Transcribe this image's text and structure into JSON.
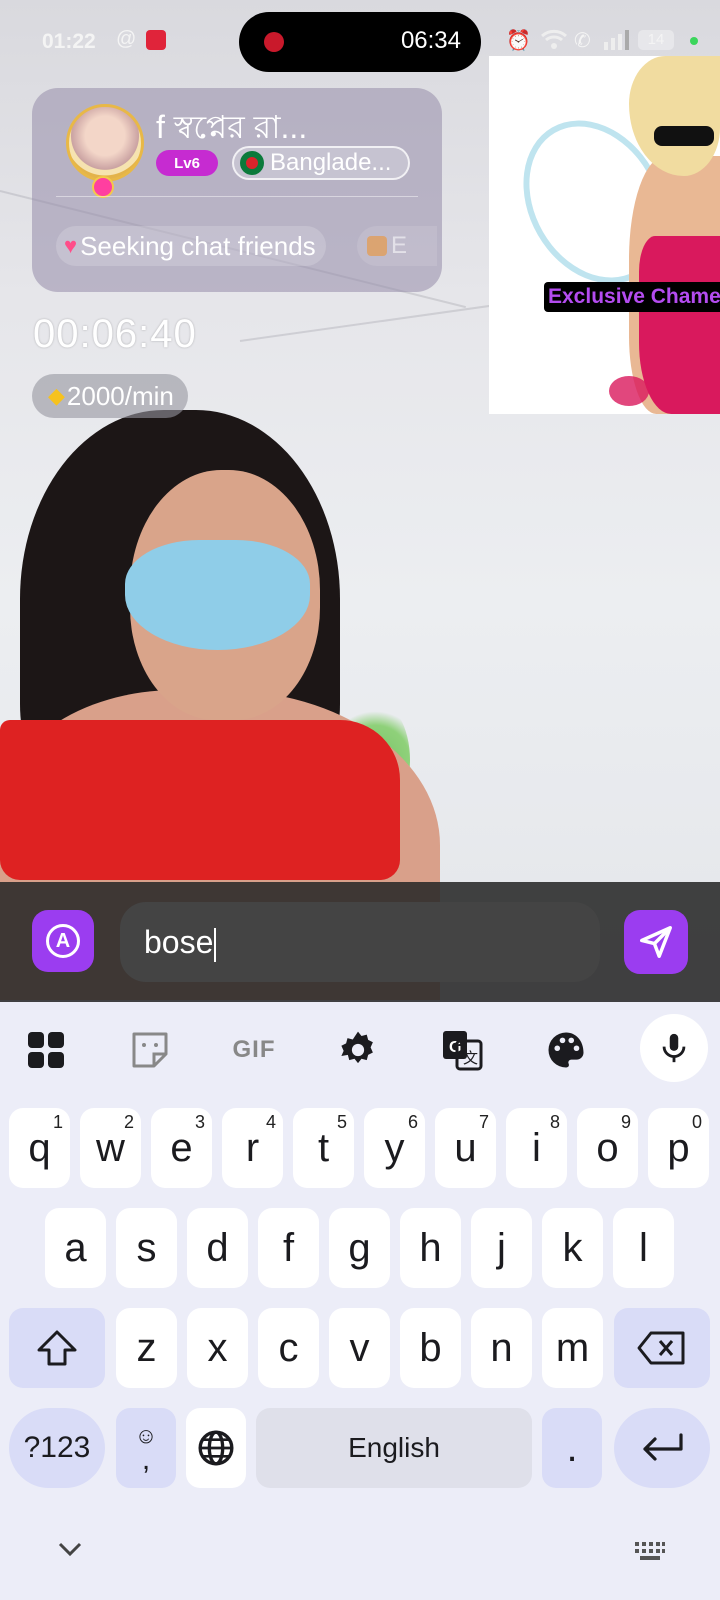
{
  "status_bar": {
    "clock": "01:22",
    "battery_level": "14",
    "recording_time": "06:34"
  },
  "profile": {
    "name": "f স্বপ্নের রা...",
    "level_badge": "Lv6",
    "country": "Banglade...",
    "tags": [
      "Seeking chat friends",
      "E"
    ]
  },
  "call": {
    "timer": "00:06:40",
    "rate": "2000/min"
  },
  "ad": {
    "label": "Exclusive Chameleon"
  },
  "chat": {
    "input_value": "bose"
  },
  "keyboard": {
    "toolbar": [
      "apps-icon",
      "sticker-icon",
      "gif-icon",
      "settings-icon",
      "translate-icon",
      "palette-icon",
      "mic-icon"
    ],
    "gif_label": "GIF",
    "row1": [
      {
        "key": "q",
        "hint": "1"
      },
      {
        "key": "w",
        "hint": "2"
      },
      {
        "key": "e",
        "hint": "3"
      },
      {
        "key": "r",
        "hint": "4"
      },
      {
        "key": "t",
        "hint": "5"
      },
      {
        "key": "y",
        "hint": "6"
      },
      {
        "key": "u",
        "hint": "7"
      },
      {
        "key": "i",
        "hint": "8"
      },
      {
        "key": "o",
        "hint": "9"
      },
      {
        "key": "p",
        "hint": "0"
      }
    ],
    "row2": [
      "a",
      "s",
      "d",
      "f",
      "g",
      "h",
      "j",
      "k",
      "l"
    ],
    "row3": [
      "z",
      "x",
      "c",
      "v",
      "b",
      "n",
      "m"
    ],
    "symbols_key": "?123",
    "emoji_key_sub": ",",
    "space_label": "English",
    "period_key": "."
  },
  "colors": {
    "accent": "#9b3df0",
    "keyboard_bg": "#ecedf8",
    "level_badge": "#c62bd1",
    "ad_label_text": "#b44cf0"
  }
}
